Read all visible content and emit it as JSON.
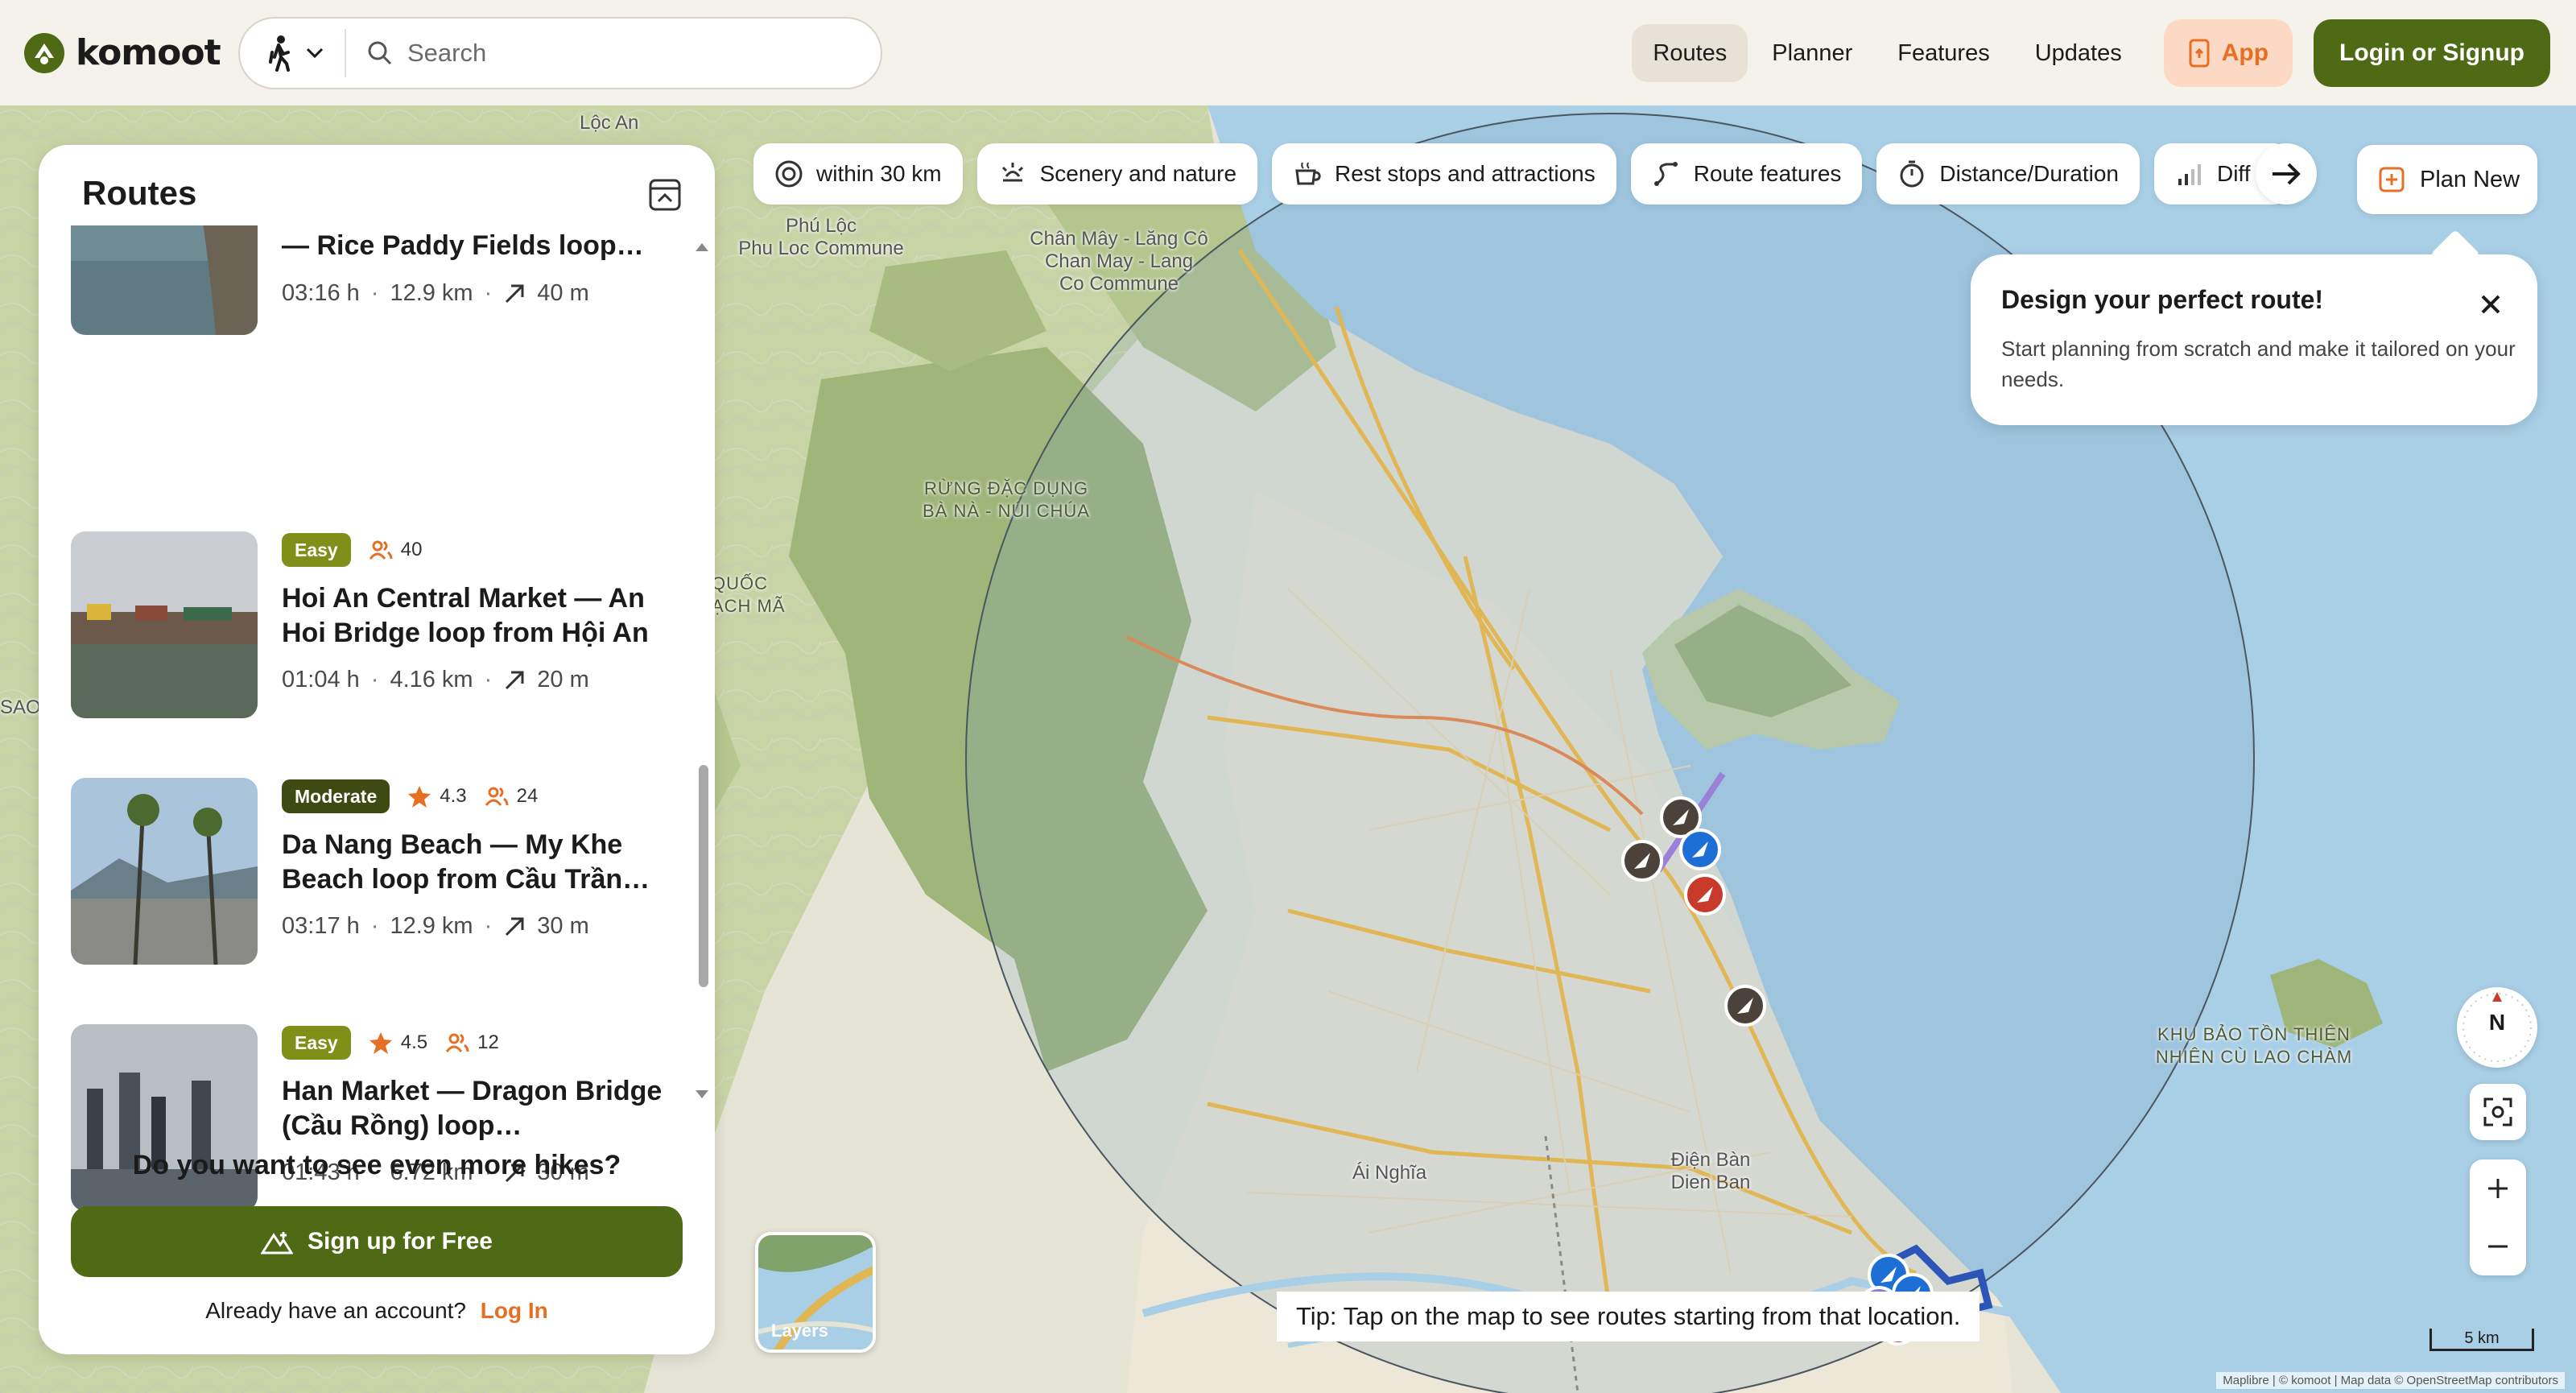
{
  "brand": {
    "name": "komoot"
  },
  "header": {
    "search_placeholder": "Search",
    "nav": [
      "Routes",
      "Planner",
      "Features",
      "Updates"
    ],
    "app_label": "App",
    "login_label": "Login or Signup"
  },
  "sidebar": {
    "title": "Routes",
    "routes": [
      {
        "name": "— Rice Paddy Fields loop…",
        "duration": "03:16 h",
        "distance": "12.9 km",
        "elevation": "40 m"
      },
      {
        "difficulty": "Easy",
        "people": "40",
        "name": "Hoi An Central Market — An Hoi Bridge loop from Hội An",
        "duration": "01:04 h",
        "distance": "4.16 km",
        "elevation": "20 m"
      },
      {
        "difficulty": "Moderate",
        "rating": "4.3",
        "people": "24",
        "name": "Da Nang Beach — My Khe Beach loop from Cầu Trần…",
        "duration": "03:17 h",
        "distance": "12.9 km",
        "elevation": "30 m"
      },
      {
        "difficulty": "Easy",
        "rating": "4.5",
        "people": "12",
        "name": "Han Market — Dragon Bridge (Cầu Rồng) loop…",
        "duration": "01:43 h",
        "distance": "6.72 km",
        "elevation": "30 m"
      }
    ],
    "more_prompt": "Do you want to see even more hikes?",
    "signup_label": "Sign up for Free",
    "account_prompt": "Already have an account?",
    "login_link": "Log In"
  },
  "filters": [
    "within 30 km",
    "Scenery and nature",
    "Rest stops and attractions",
    "Route features",
    "Distance/Duration",
    "Diff"
  ],
  "plan_new": "Plan New",
  "tooltip": {
    "title": "Design your perfect route!",
    "body": "Start planning from scratch and make it tailored on your needs."
  },
  "map": {
    "compass_label": "N",
    "layers_label": "Layers",
    "tip": "Tip: Tap on the map to see routes starting from that location.",
    "scale": "5 km",
    "attribution": "Maplibre | © komoot | Map data © OpenStreetMap contributors",
    "labels": [
      "Lộc An",
      "Phú Lộc\nPhu Loc Commune",
      "Chân Mây - Lăng Cô\nChan May - Lang\nCo Commune",
      "RỪNG ĐẶC DỤNG\nBÀ NÀ - NÚI CHÚA",
      "QUỐC\nẠCH MÃ",
      "SAO",
      "Ái Nghĩa",
      "Điện Bàn\nDien Ban",
      "KHU BẢO TỒN THIÊN\nNHIÊN CÙ LAO CHÀM"
    ]
  },
  "colors": {
    "brand": "#4f6a15",
    "accent": "#e76f24",
    "sea": "#a9cfe6"
  }
}
